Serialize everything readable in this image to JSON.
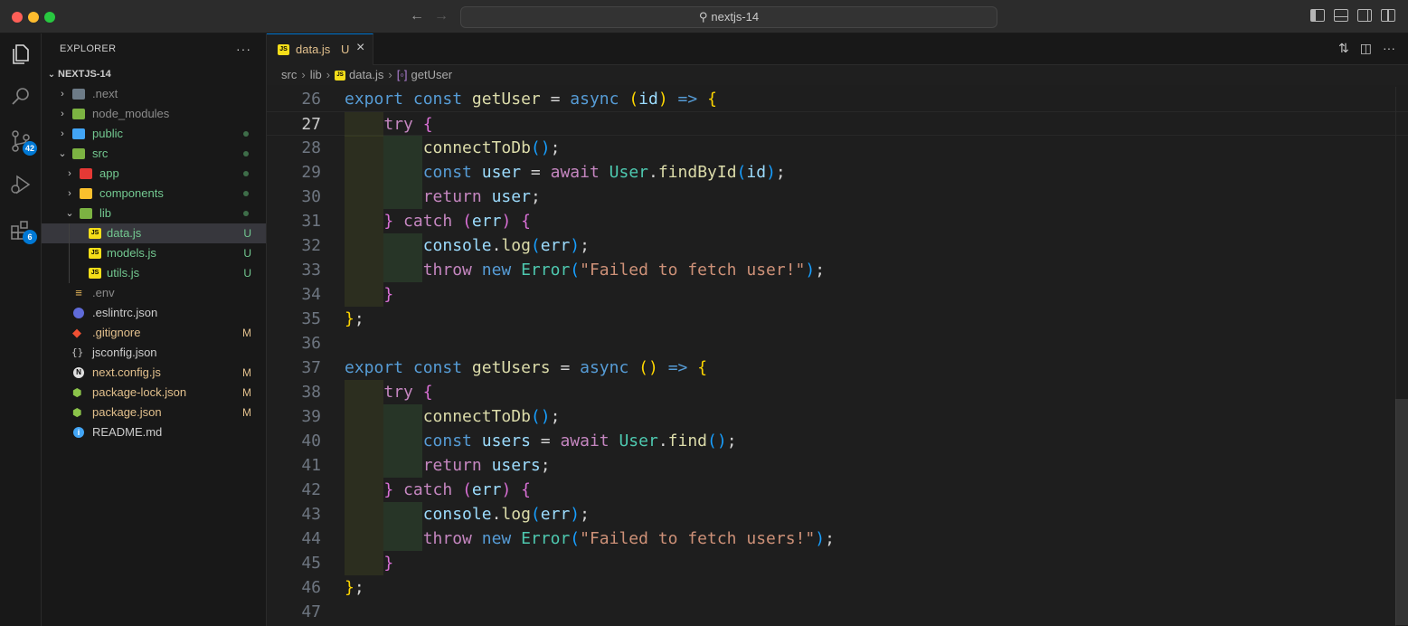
{
  "window": {
    "search_label": "nextjs-14"
  },
  "activity": {
    "source_control_badge": "42",
    "extensions_badge": "6"
  },
  "explorer": {
    "header": "EXPLORER",
    "more": "···",
    "section": "NEXTJS-14",
    "items": [
      {
        "name": ".next",
        "color": "#8b8b8b"
      },
      {
        "name": "node_modules",
        "color": "#8b8b8b"
      },
      {
        "name": "public",
        "color": "#73c991"
      },
      {
        "name": "src",
        "color": "#73c991"
      },
      {
        "name": "app",
        "color": "#73c991"
      },
      {
        "name": "components",
        "color": "#73c991"
      },
      {
        "name": "lib",
        "color": "#73c991"
      },
      {
        "name": "data.js",
        "status": "U",
        "color": "#73c991"
      },
      {
        "name": "models.js",
        "status": "U",
        "color": "#73c991"
      },
      {
        "name": "utils.js",
        "status": "U",
        "color": "#73c991"
      },
      {
        "name": ".env",
        "color": "#8b8b8b"
      },
      {
        "name": ".eslintrc.json",
        "color": "#cccccc"
      },
      {
        "name": ".gitignore",
        "status": "M",
        "color": "#e2c08d"
      },
      {
        "name": "jsconfig.json",
        "color": "#cccccc"
      },
      {
        "name": "next.config.js",
        "status": "M",
        "color": "#e2c08d"
      },
      {
        "name": "package-lock.json",
        "status": "M",
        "color": "#e2c08d"
      },
      {
        "name": "package.json",
        "status": "M",
        "color": "#e2c08d"
      },
      {
        "name": "README.md",
        "color": "#cccccc"
      }
    ]
  },
  "editor": {
    "tab": {
      "label": "data.js",
      "status": "U",
      "close": "×"
    },
    "breadcrumb": [
      "src",
      "lib",
      "data.js",
      "getUser"
    ],
    "lines": [
      {
        "n": "26",
        "tokens": [
          [
            "kw",
            "export"
          ],
          [
            "op",
            " "
          ],
          [
            "kw",
            "const"
          ],
          [
            "op",
            " "
          ],
          [
            "fn",
            "getUser"
          ],
          [
            "op",
            " = "
          ],
          [
            "kw",
            "async"
          ],
          [
            "op",
            " "
          ],
          [
            "b1",
            "("
          ],
          [
            "var",
            "id"
          ],
          [
            "b1",
            ")"
          ],
          [
            "op",
            " "
          ],
          [
            "kw",
            "=>"
          ],
          [
            "op",
            " "
          ],
          [
            "b1",
            "{"
          ]
        ]
      },
      {
        "n": "27",
        "tokens": [
          [
            "op",
            "    "
          ],
          [
            "ctl",
            "try"
          ],
          [
            "op",
            " "
          ],
          [
            "b2",
            "{"
          ]
        ]
      },
      {
        "n": "28",
        "tokens": [
          [
            "op",
            "        "
          ],
          [
            "fn",
            "connectToDb"
          ],
          [
            "b3",
            "()"
          ],
          [
            "op",
            ";"
          ]
        ]
      },
      {
        "n": "29",
        "tokens": [
          [
            "op",
            "        "
          ],
          [
            "kw",
            "const"
          ],
          [
            "op",
            " "
          ],
          [
            "var",
            "user"
          ],
          [
            "op",
            " = "
          ],
          [
            "ctl",
            "await"
          ],
          [
            "op",
            " "
          ],
          [
            "cls",
            "User"
          ],
          [
            "op",
            "."
          ],
          [
            "fn",
            "findById"
          ],
          [
            "b3",
            "("
          ],
          [
            "var",
            "id"
          ],
          [
            "b3",
            ")"
          ],
          [
            "op",
            ";"
          ]
        ]
      },
      {
        "n": "30",
        "tokens": [
          [
            "op",
            "        "
          ],
          [
            "ctl",
            "return"
          ],
          [
            "op",
            " "
          ],
          [
            "var",
            "user"
          ],
          [
            "op",
            ";"
          ]
        ]
      },
      {
        "n": "31",
        "tokens": [
          [
            "op",
            "    "
          ],
          [
            "b2",
            "}"
          ],
          [
            "op",
            " "
          ],
          [
            "ctl",
            "catch"
          ],
          [
            "op",
            " "
          ],
          [
            "b2",
            "("
          ],
          [
            "var",
            "err"
          ],
          [
            "b2",
            ")"
          ],
          [
            "op",
            " "
          ],
          [
            "b2",
            "{"
          ]
        ]
      },
      {
        "n": "32",
        "tokens": [
          [
            "op",
            "        "
          ],
          [
            "var",
            "console"
          ],
          [
            "op",
            "."
          ],
          [
            "fn",
            "log"
          ],
          [
            "b3",
            "("
          ],
          [
            "var",
            "err"
          ],
          [
            "b3",
            ")"
          ],
          [
            "op",
            ";"
          ]
        ]
      },
      {
        "n": "33",
        "tokens": [
          [
            "op",
            "        "
          ],
          [
            "ctl",
            "throw"
          ],
          [
            "op",
            " "
          ],
          [
            "kw",
            "new"
          ],
          [
            "op",
            " "
          ],
          [
            "cls",
            "Error"
          ],
          [
            "b3",
            "("
          ],
          [
            "str",
            "\"Failed to fetch user!\""
          ],
          [
            "b3",
            ")"
          ],
          [
            "op",
            ";"
          ]
        ]
      },
      {
        "n": "34",
        "tokens": [
          [
            "op",
            "    "
          ],
          [
            "b2",
            "}"
          ]
        ]
      },
      {
        "n": "35",
        "tokens": [
          [
            "b1",
            "}"
          ],
          [
            "op",
            ";"
          ]
        ]
      },
      {
        "n": "36",
        "tokens": []
      },
      {
        "n": "37",
        "tokens": [
          [
            "kw",
            "export"
          ],
          [
            "op",
            " "
          ],
          [
            "kw",
            "const"
          ],
          [
            "op",
            " "
          ],
          [
            "fn",
            "getUsers"
          ],
          [
            "op",
            " = "
          ],
          [
            "kw",
            "async"
          ],
          [
            "op",
            " "
          ],
          [
            "b1",
            "()"
          ],
          [
            "op",
            " "
          ],
          [
            "kw",
            "=>"
          ],
          [
            "op",
            " "
          ],
          [
            "b1",
            "{"
          ]
        ]
      },
      {
        "n": "38",
        "tokens": [
          [
            "op",
            "    "
          ],
          [
            "ctl",
            "try"
          ],
          [
            "op",
            " "
          ],
          [
            "b2",
            "{"
          ]
        ]
      },
      {
        "n": "39",
        "tokens": [
          [
            "op",
            "        "
          ],
          [
            "fn",
            "connectToDb"
          ],
          [
            "b3",
            "()"
          ],
          [
            "op",
            ";"
          ]
        ]
      },
      {
        "n": "40",
        "tokens": [
          [
            "op",
            "        "
          ],
          [
            "kw",
            "const"
          ],
          [
            "op",
            " "
          ],
          [
            "var",
            "users"
          ],
          [
            "op",
            " = "
          ],
          [
            "ctl",
            "await"
          ],
          [
            "op",
            " "
          ],
          [
            "cls",
            "User"
          ],
          [
            "op",
            "."
          ],
          [
            "fn",
            "find"
          ],
          [
            "b3",
            "()"
          ],
          [
            "op",
            ";"
          ]
        ]
      },
      {
        "n": "41",
        "tokens": [
          [
            "op",
            "        "
          ],
          [
            "ctl",
            "return"
          ],
          [
            "op",
            " "
          ],
          [
            "var",
            "users"
          ],
          [
            "op",
            ";"
          ]
        ]
      },
      {
        "n": "42",
        "tokens": [
          [
            "op",
            "    "
          ],
          [
            "b2",
            "}"
          ],
          [
            "op",
            " "
          ],
          [
            "ctl",
            "catch"
          ],
          [
            "op",
            " "
          ],
          [
            "b2",
            "("
          ],
          [
            "var",
            "err"
          ],
          [
            "b2",
            ")"
          ],
          [
            "op",
            " "
          ],
          [
            "b2",
            "{"
          ]
        ]
      },
      {
        "n": "43",
        "tokens": [
          [
            "op",
            "        "
          ],
          [
            "var",
            "console"
          ],
          [
            "op",
            "."
          ],
          [
            "fn",
            "log"
          ],
          [
            "b3",
            "("
          ],
          [
            "var",
            "err"
          ],
          [
            "b3",
            ")"
          ],
          [
            "op",
            ";"
          ]
        ]
      },
      {
        "n": "44",
        "tokens": [
          [
            "op",
            "        "
          ],
          [
            "ctl",
            "throw"
          ],
          [
            "op",
            " "
          ],
          [
            "kw",
            "new"
          ],
          [
            "op",
            " "
          ],
          [
            "cls",
            "Error"
          ],
          [
            "b3",
            "("
          ],
          [
            "str",
            "\"Failed to fetch users!\""
          ],
          [
            "b3",
            ")"
          ],
          [
            "op",
            ";"
          ]
        ]
      },
      {
        "n": "45",
        "tokens": [
          [
            "op",
            "    "
          ],
          [
            "b2",
            "}"
          ]
        ]
      },
      {
        "n": "46",
        "tokens": [
          [
            "b1",
            "}"
          ],
          [
            "op",
            ";"
          ]
        ]
      },
      {
        "n": "47",
        "tokens": []
      }
    ],
    "current_line": "27"
  }
}
